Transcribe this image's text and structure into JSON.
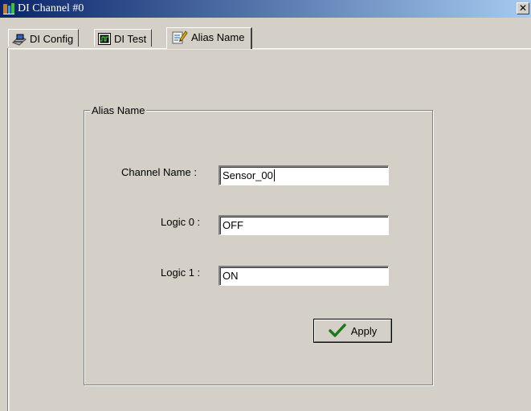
{
  "window": {
    "title": "DI Channel #0",
    "close_glyph": "✕",
    "icon": "app-icon"
  },
  "tabs": [
    {
      "label": "DI Config",
      "icon": "config-icon",
      "active": false
    },
    {
      "label": "DI Test",
      "icon": "test-icon",
      "active": false
    },
    {
      "label": "Alias Name",
      "icon": "edit-icon",
      "active": true
    }
  ],
  "alias_group": {
    "title": "Alias Name",
    "channel_name_label": "Channel Name :",
    "channel_name_value": "Sensor_00",
    "logic0_label": "Logic 0 :",
    "logic0_value": "OFF",
    "logic1_label": "Logic 1 :",
    "logic1_value": "ON"
  },
  "apply_button": {
    "label": "Apply",
    "icon": "checkmark-icon",
    "icon_color": "#1a7a1a"
  },
  "colors": {
    "title_start": "#0a246a",
    "title_end": "#a6caf0",
    "face": "#d4d0c8"
  }
}
